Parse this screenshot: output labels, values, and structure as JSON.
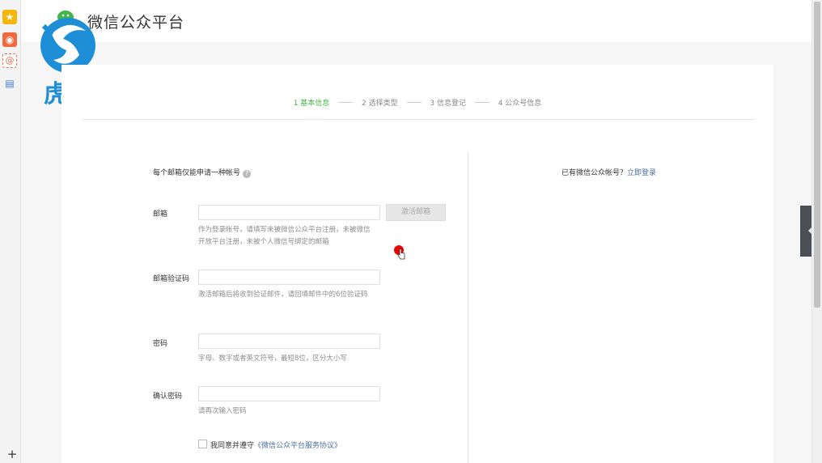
{
  "header": {
    "title": "微信公众平台"
  },
  "watermark": {
    "text": "虎观"
  },
  "steps": [
    {
      "label": "1 基本信息",
      "active": true
    },
    {
      "label": "2 选择类型",
      "active": false
    },
    {
      "label": "3 信息登记",
      "active": false
    },
    {
      "label": "4 公众号信息",
      "active": false
    }
  ],
  "form": {
    "heading": "每个邮箱仅能申请一种帐号",
    "help_icon": "?",
    "email": {
      "label": "邮箱",
      "value": "",
      "hint": "作为登录帐号，请填写未被微信公众平台注册，未被微信开放平台注册，未被个人微信号绑定的邮箱",
      "button": "激活邮箱"
    },
    "code": {
      "label": "邮箱验证码",
      "value": "",
      "hint": "激活邮箱后将收到验证邮件，请回填邮件中的6位验证码"
    },
    "password": {
      "label": "密码",
      "value": "",
      "hint": "字母、数字或者英文符号，最短8位，区分大小写"
    },
    "confirm": {
      "label": "确认密码",
      "value": "",
      "hint": "请再次输入密码"
    },
    "agree": {
      "prefix": "我同意并遵守",
      "link": "《微信公众平台服务协议》"
    }
  },
  "login": {
    "question": "已有微信公众帐号？",
    "link": "立即登录"
  },
  "sidebar": {
    "favorites_icon": "★",
    "weibo_icon": "◉",
    "mail_icon": "@",
    "note_icon": "▤",
    "add_icon": "+"
  },
  "colors": {
    "accent": "#44b549",
    "link": "#4c6c9c"
  }
}
